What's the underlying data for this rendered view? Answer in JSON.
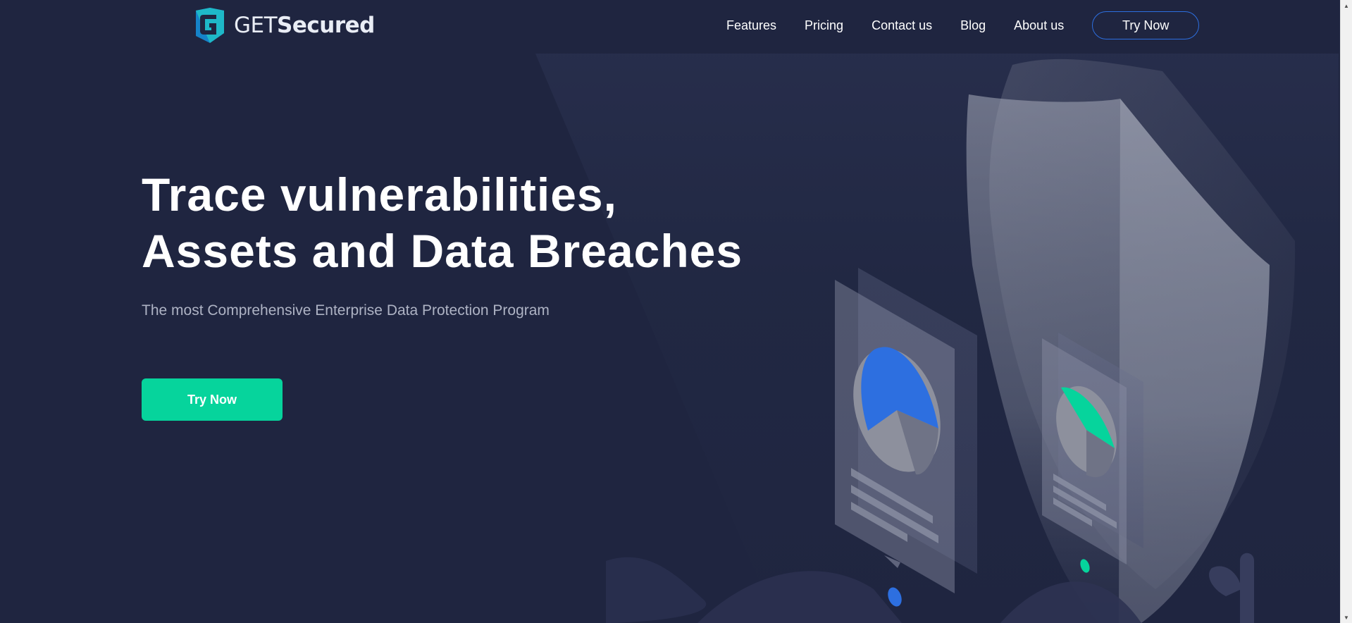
{
  "header": {
    "logo": {
      "icon": "g-shield-logo-icon",
      "text_light": "GET",
      "text_bold": "Secured"
    },
    "nav": [
      {
        "label": "Features"
      },
      {
        "label": "Pricing"
      },
      {
        "label": "Contact us"
      },
      {
        "label": "Blog"
      },
      {
        "label": "About us"
      }
    ],
    "try_now_label": "Try Now"
  },
  "hero": {
    "headline_line1": "Trace vulnerabilities,",
    "headline_line2": "Assets and Data Breaches",
    "subheadline": "The most Comprehensive Enterprise Data Protection Program",
    "cta_label": "Try Now"
  },
  "colors": {
    "background": "#1f2540",
    "accent_green": "#06d49c",
    "accent_blue": "#2d6fe0",
    "logo_teal": "#1eb8c8"
  },
  "illustration": {
    "icon": "security-shield-reports-illustration"
  }
}
